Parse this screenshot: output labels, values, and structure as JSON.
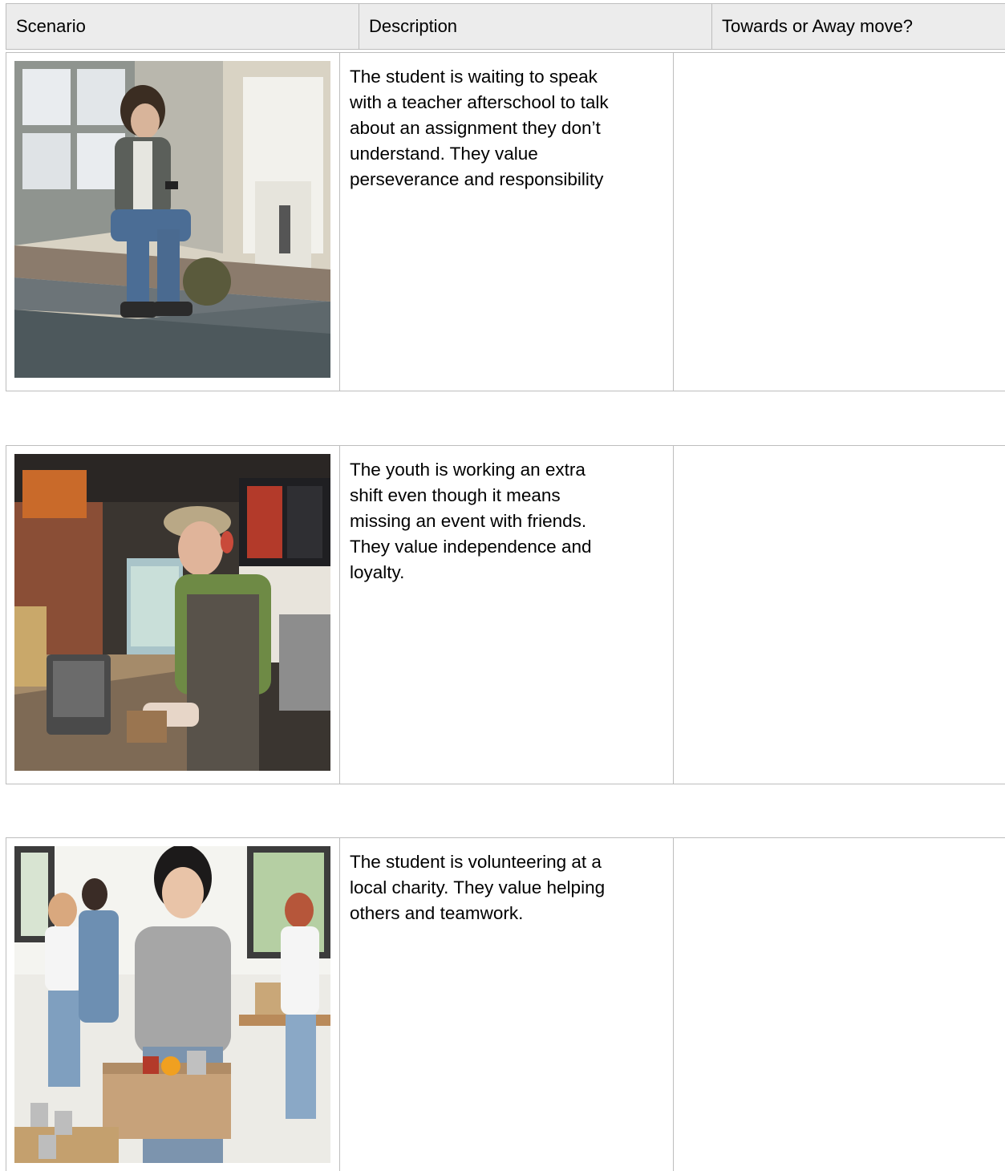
{
  "header": {
    "col1": "Scenario",
    "col2": "Description",
    "col3": "Towards or Away move?"
  },
  "rows": [
    {
      "image": "photo of a student sitting on a window ledge above school steps, holding a phone, backpack beside them",
      "description": "The student is waiting to speak\nwith a teacher afterschool to talk\nabout an assignment they don’t\nunderstand. They value\nperseverance and responsibility",
      "answer": ""
    },
    {
      "image": "photo of a young worker in cap and apron at a fast-food counter register",
      "description": "The youth is working an extra\nshift even though it means\nmissing an event with friends.\nThey value independence and\nloyalty.",
      "answer": ""
    },
    {
      "image": "photo of a smiling student holding a cardboard box of food at a charity with other volunteers",
      "description": "The student is volunteering at a\nlocal charity. They value helping\nothers and teamwork.",
      "answer": ""
    }
  ]
}
